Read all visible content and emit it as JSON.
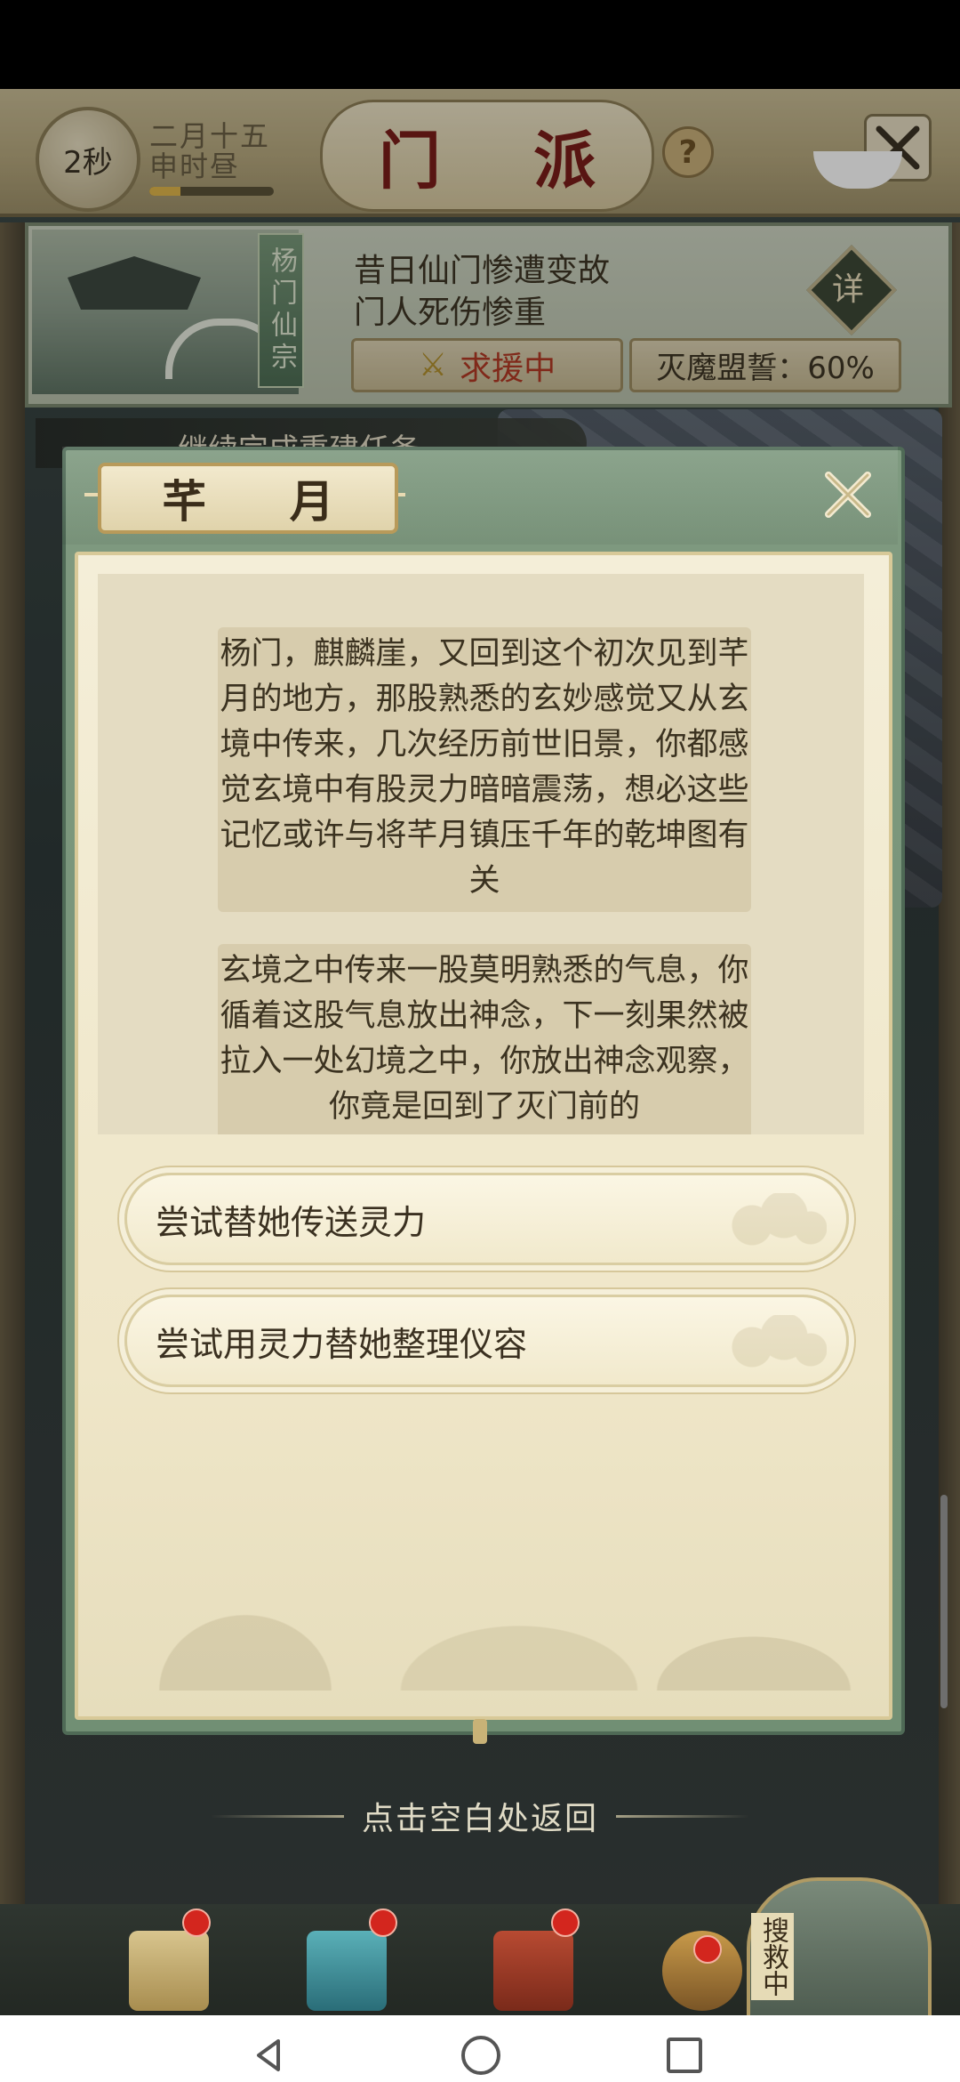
{
  "header": {
    "timer": "2秒",
    "date_line1": "二月十五",
    "date_line2": "申时昼",
    "title": "门 派",
    "help_glyph": "?",
    "timer_progress": 0.25
  },
  "sect": {
    "name": "杨门仙宗",
    "desc_line1": "昔日仙门惨遭变故",
    "desc_line2": "门人死伤惨重",
    "rescue_label": "求援中",
    "alliance_label": "灭魔盟誓：60%",
    "detail_label": "详"
  },
  "quest_strip": {
    "text": "继续完成重建任务"
  },
  "dialog": {
    "title": "芊 月",
    "story": [
      "杨门，麒麟崖，又回到这个初次见到芊月的地方，那股熟悉的玄妙感觉又从玄境中传来，几次经历前世旧景，你都感觉玄境中有股灵力暗暗震荡，想必这些记忆或许与将芊月镇压千年的乾坤图有关",
      "玄境之中传来一股莫明熟悉的气息，你循着这股气息放出神念，下一刻果然被拉入一处幻境之中，你放出神念观察，你竟是回到了灭门前的"
    ],
    "choices": [
      "尝试替她传送灵力",
      "尝试用灵力替她整理仪容"
    ]
  },
  "return_hint": "点击空白处返回",
  "search_rescue": "搜救中",
  "colors": {
    "title_red": "#7a1e1a",
    "rescue_red": "#b23a24",
    "dialog_green": "#7f9a80",
    "parchment": "#f4eed8"
  },
  "icons": {
    "close": "close-icon",
    "swords": "crossed-swords-icon",
    "help": "question-icon"
  }
}
